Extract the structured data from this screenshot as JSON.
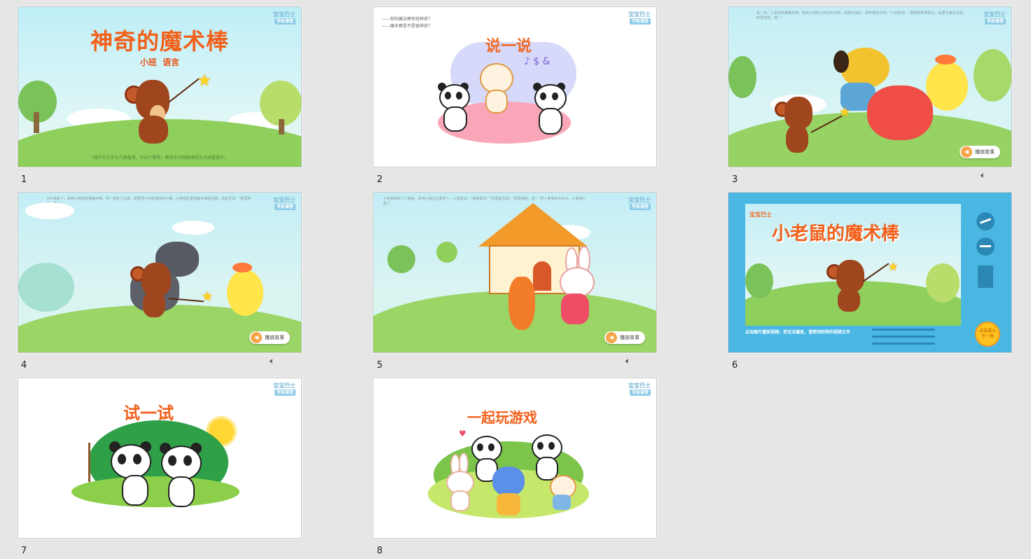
{
  "slides": [
    {
      "number": "1",
      "title": "神奇的魔术棒",
      "subtitle": "小班  语言",
      "footer_note": "*课件中文字为方便备课，可自行删除；教师也可根据课程实况调整课件。",
      "logo": "宝宝巴士",
      "logo_sub": "学前课堂"
    },
    {
      "number": "2",
      "title": "说一说",
      "questions": [
        "——你的魔法棒有啥神奇？",
        "——魔术棒是不是很神奇？"
      ],
      "logo": "宝宝巴士",
      "logo_sub": "学前课堂"
    },
    {
      "number": "3",
      "story_text": "有一天，小老鼠拿着魔术棒，看到小狗狗小鸡在吃东西，他想出来好，把苹果变大吧！\"小狗狗说：\"要想把苹果变大，就要念魔法咒语：噼里啪啦，变！\"",
      "play_label": "播放故事",
      "logo": "宝宝巴士",
      "logo_sub": "学前课堂"
    },
    {
      "number": "4",
      "story_text": "大灰狼来了，看到小老鼠拿着魔术棒，他一把抢了过来，想要把小鸡变成他的午餐。小老鼠赶紧把魔术棒抢回来，念起咒语：\"噼里啪啦，变！\"",
      "play_label": "播放故事",
      "logo": "宝宝巴士",
      "logo_sub": "学前课堂"
    },
    {
      "number": "5",
      "story_text": "小老鼠来到了小兔家，看到小兔正在拔萝卜，小老鼠说：\"我来帮你！\"他念起咒语：\"噼里啪啦，变！\"萝卜变得好大好大，小兔高兴极了。",
      "play_label": "播放故事",
      "logo": "宝宝巴士",
      "logo_sub": "学前课堂"
    },
    {
      "number": "6",
      "video_title": "小老鼠的魔术棒",
      "brand": "宝宝巴士",
      "hint": "点击图片播放视频；若无法播放，请使用附带的视频文件",
      "next_label": "点击进入下一页"
    },
    {
      "number": "7",
      "title": "试一试",
      "logo": "宝宝巴士",
      "logo_sub": "学前课堂"
    },
    {
      "number": "8",
      "title": "一起玩游戏",
      "logo": "宝宝巴士",
      "logo_sub": "学前课堂"
    }
  ],
  "colors": {
    "title_orange": "#f2601a",
    "sky": "#c9eef5",
    "grass": "#9bd46a",
    "video_panel": "#4ab7e3"
  },
  "icons": {
    "audio": "speaker-icon"
  }
}
